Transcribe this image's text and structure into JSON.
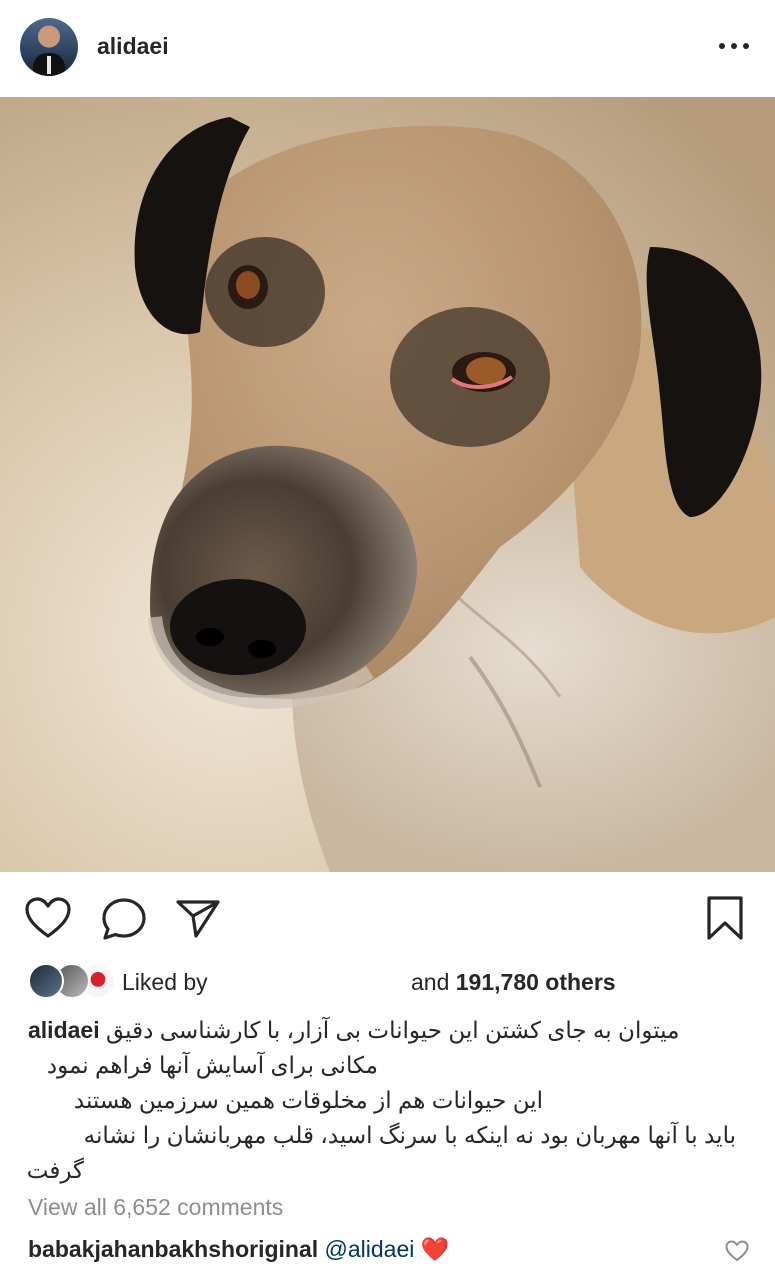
{
  "post": {
    "username": "alidaei",
    "more_icon": "more-horizontal-icon"
  },
  "actions": {
    "like_icon": "heart-outline-icon",
    "comment_icon": "comment-bubble-icon",
    "share_icon": "paper-plane-icon",
    "save_icon": "bookmark-icon"
  },
  "likes": {
    "liked_by": "Liked by",
    "and": "and",
    "count_text": "191,780 others"
  },
  "caption": {
    "username": "alidaei",
    "line1": "میتوان به جای کشتن این حیوانات بی آزار، با کارشناسی دقیق",
    "line2": "مکانی برای آسایش آنها فراهم نمود",
    "line3": "این حیوانات هم از مخلوقات همین سرزمین هستند",
    "line4": "باید با آنها مهربان بود نه اینکه با سرنگ اسید، قلب مهربانشان را نشانه",
    "line5": "گرفت"
  },
  "comments": {
    "view_all": "View all 6,652 comments",
    "first": {
      "username": "babakjahanbakhshoriginal",
      "mention": "@alidaei",
      "emoji": "❤️"
    }
  },
  "colors": {
    "text": "#262626",
    "muted": "#8e8e8e",
    "mention": "#003569",
    "heart_red": "#ed4956"
  }
}
